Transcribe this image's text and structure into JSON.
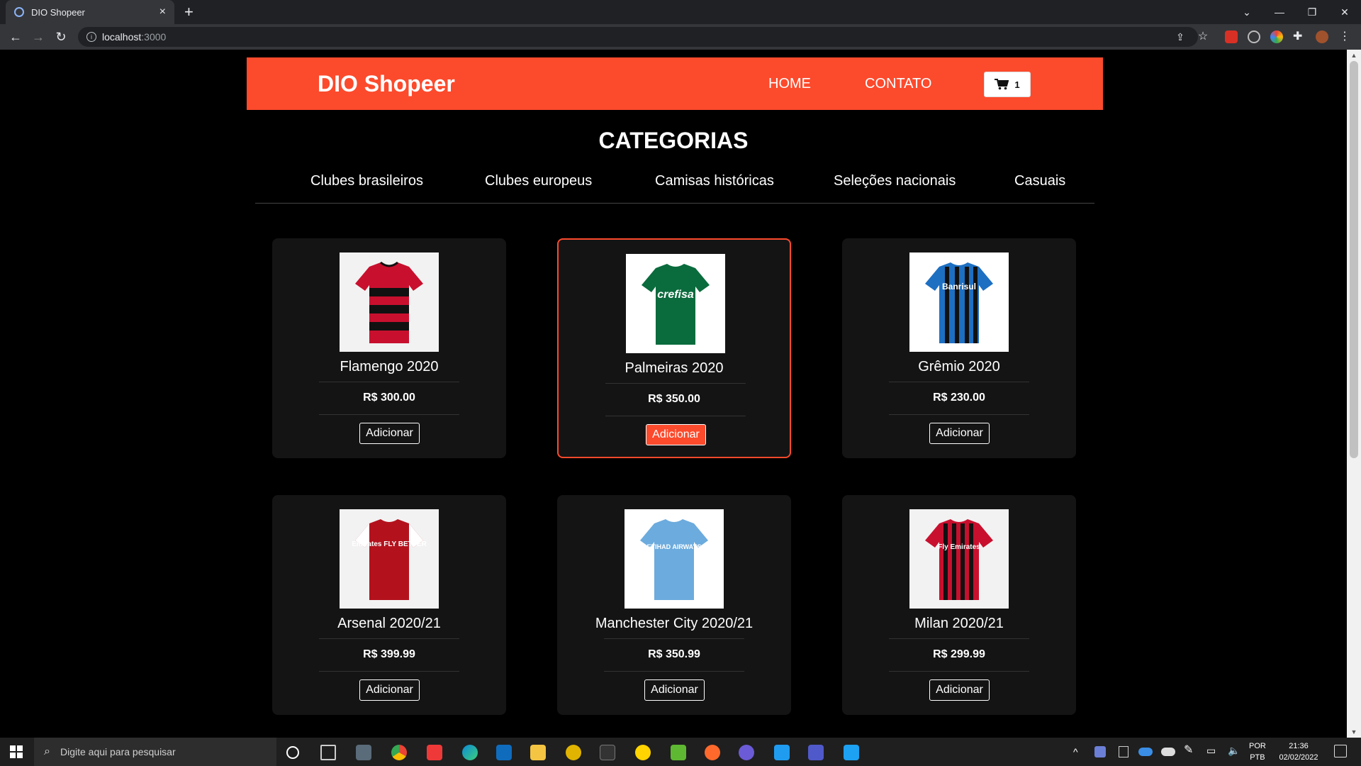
{
  "browser": {
    "tab_title": "DIO Shopeer",
    "tab_close": "×",
    "new_tab": "+",
    "url_host": "localhost",
    "url_port": ":3000"
  },
  "header": {
    "brand": "DIO Shopeer",
    "nav": [
      "HOME",
      "CONTATO"
    ],
    "cart_count": "1"
  },
  "categories": {
    "title": "CATEGORIAS",
    "items": [
      "Clubes brasileiros",
      "Clubes europeus",
      "Camisas históricas",
      "Seleções nacionais",
      "Casuais"
    ]
  },
  "products": [
    {
      "name": "Flamengo 2020",
      "price": "R$ 300.00",
      "button": "Adicionar",
      "colors": [
        "#c8102e",
        "#111111"
      ]
    },
    {
      "name": "Palmeiras 2020",
      "price": "R$ 350.00",
      "button": "Adicionar",
      "colors": [
        "#0a6b3d",
        "#ffffff"
      ],
      "text": "crefisa"
    },
    {
      "name": "Grêmio 2020",
      "price": "R$ 230.00",
      "button": "Adicionar",
      "colors": [
        "#1d6fc2",
        "#111111"
      ],
      "text": "Banrisul"
    },
    {
      "name": "Arsenal 2020/21",
      "price": "R$ 399.99",
      "button": "Adicionar",
      "colors": [
        "#b3121d",
        "#ffffff"
      ],
      "text": "Emirates FLY BETTER"
    },
    {
      "name": "Manchester City 2020/21",
      "price": "R$ 350.99",
      "button": "Adicionar",
      "colors": [
        "#6cabdd",
        "#ffffff"
      ],
      "text": "ETIHAD AIRWAYS"
    },
    {
      "name": "Milan 2020/21",
      "price": "R$ 299.99",
      "button": "Adicionar",
      "colors": [
        "#c8102e",
        "#111111"
      ],
      "text": "Fly Emirates"
    }
  ],
  "taskbar": {
    "search_placeholder": "Digite aqui para pesquisar",
    "lang1": "POR",
    "lang2": "PTB",
    "time": "21:36",
    "date": "02/02/2022"
  },
  "colors": {
    "accent": "#fc4a2c",
    "card_bg": "#141414"
  }
}
